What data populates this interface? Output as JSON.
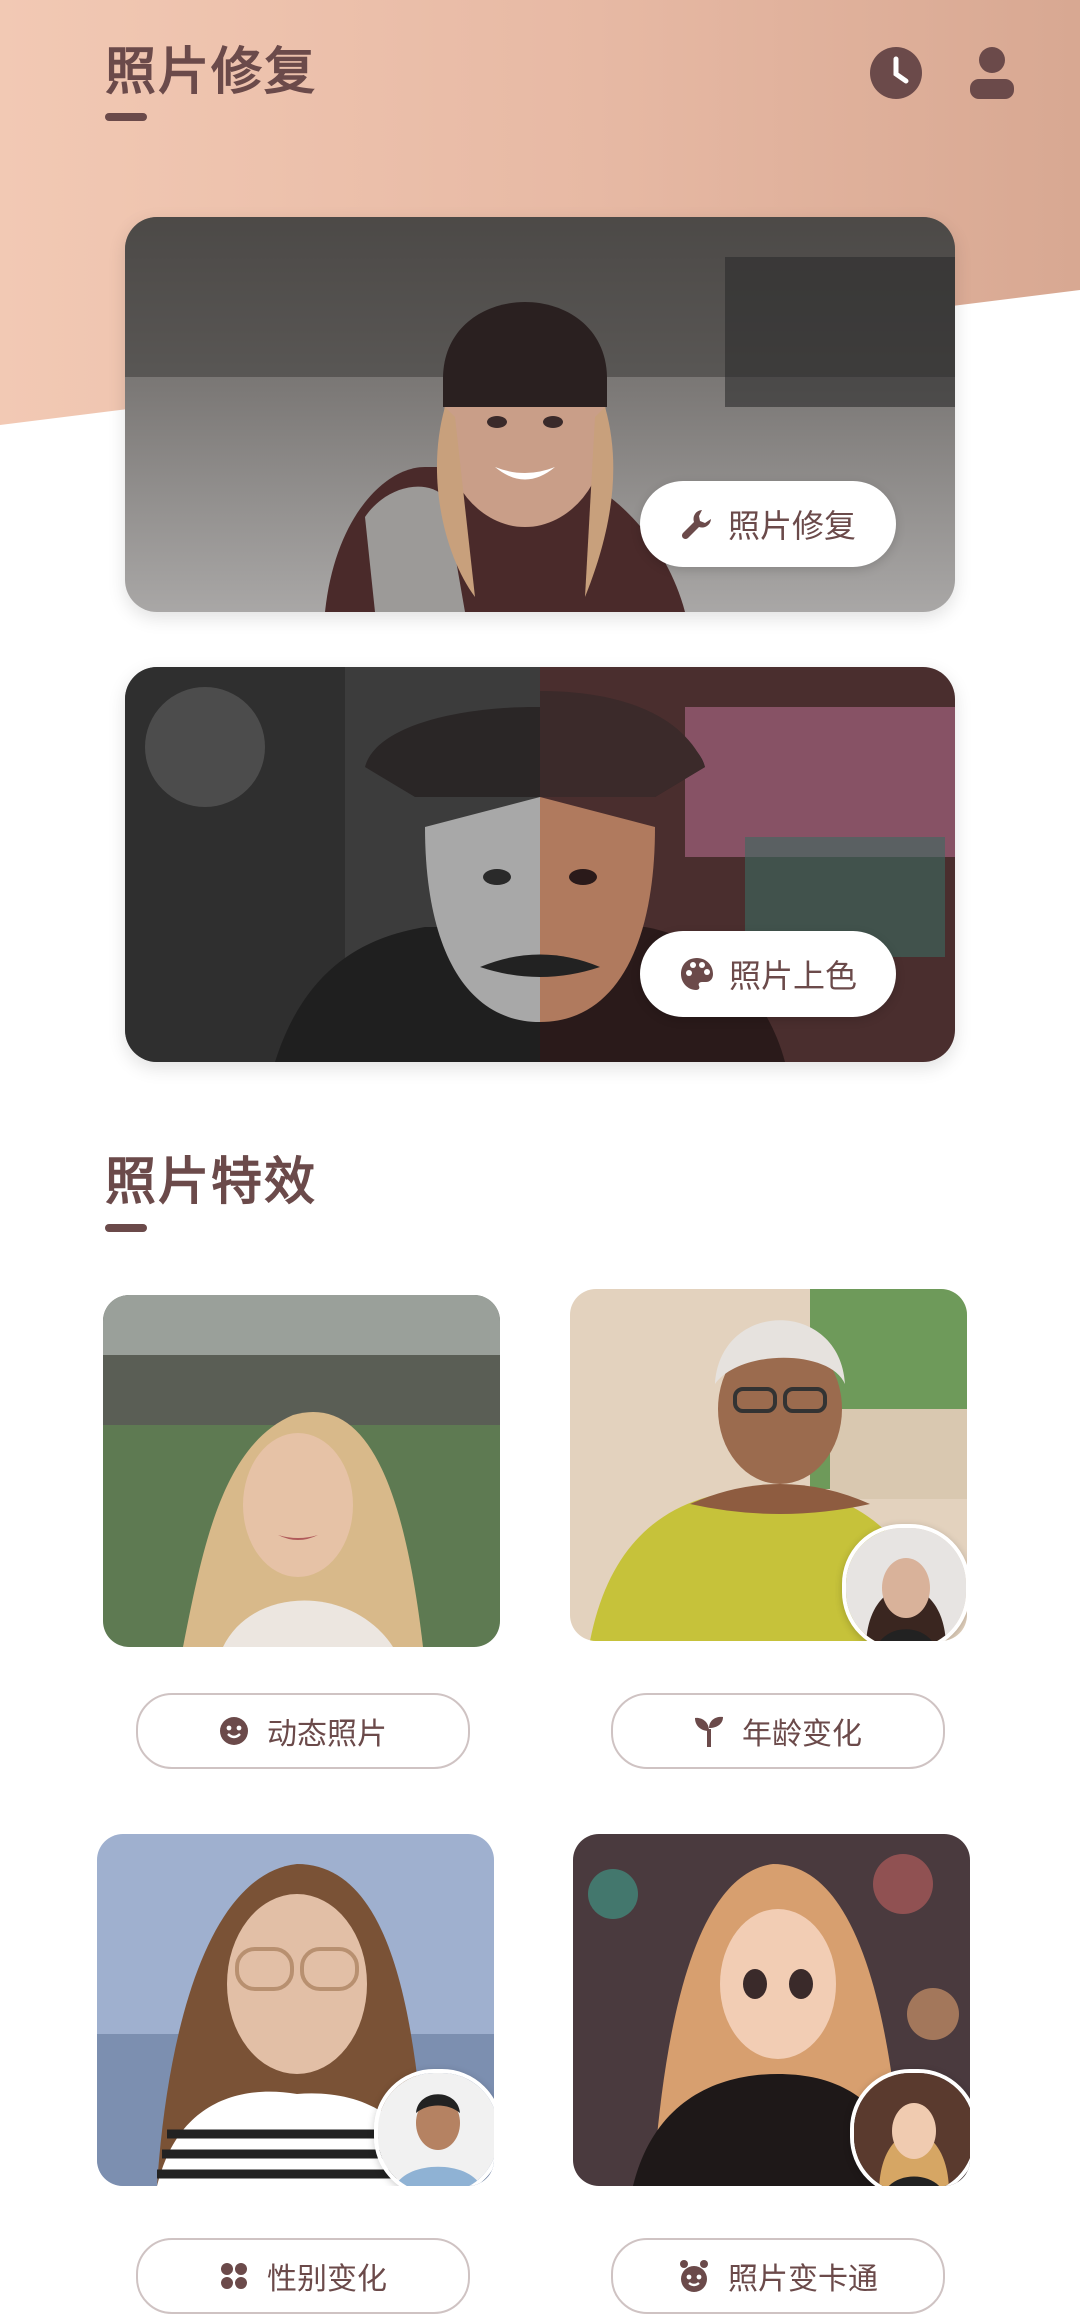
{
  "header": {
    "title": "照片修复",
    "history_icon": "clock-icon",
    "profile_icon": "user-icon"
  },
  "hero_cards": [
    {
      "label": "照片修复",
      "icon": "wrench-icon"
    },
    {
      "label": "照片上色",
      "icon": "palette-icon"
    }
  ],
  "effects": {
    "title": "照片特效",
    "items": [
      {
        "label": "动态照片",
        "icon": "smile-icon"
      },
      {
        "label": "年龄变化",
        "icon": "sprout-icon"
      },
      {
        "label": "性别变化",
        "icon": "gender-icon"
      },
      {
        "label": "照片变卡通",
        "icon": "cartoon-icon"
      }
    ]
  },
  "colors": {
    "brand": "#6b4a4a",
    "band": "#e7b9a4"
  }
}
